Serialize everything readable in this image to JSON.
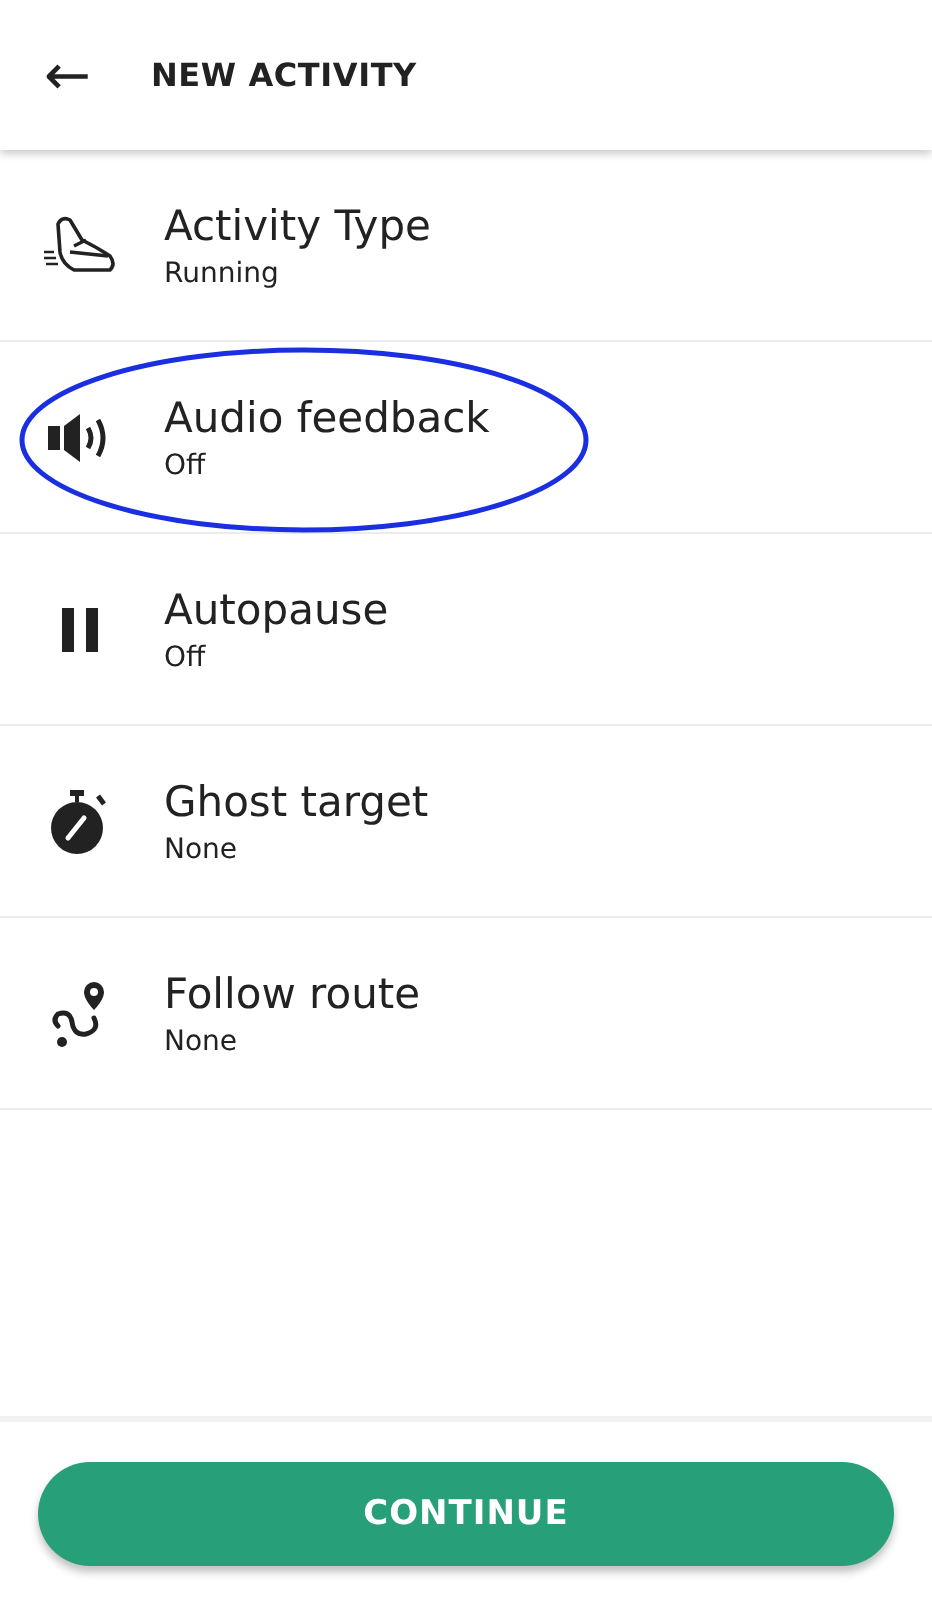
{
  "header": {
    "back": "←",
    "title": "NEW ACTIVITY"
  },
  "settings": [
    {
      "kind": "shoe",
      "label": "Activity Type",
      "value": "Running",
      "highlighted": false
    },
    {
      "kind": "speaker",
      "label": "Audio feedback",
      "value": "Off",
      "highlighted": true
    },
    {
      "kind": "pause",
      "label": "Autopause",
      "value": "Off",
      "highlighted": false
    },
    {
      "kind": "stopwatch",
      "label": "Ghost target",
      "value": "None",
      "highlighted": false
    },
    {
      "kind": "route",
      "label": "Follow route",
      "value": "None",
      "highlighted": false
    }
  ],
  "continue_button": "CONTINUE"
}
